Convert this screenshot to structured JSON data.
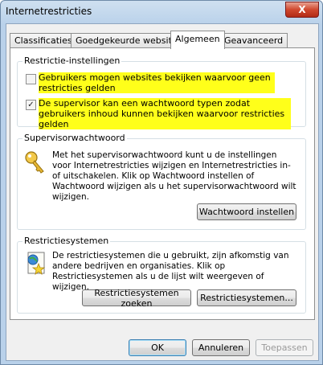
{
  "window": {
    "title": "Internetrestricties",
    "close_glyph": "X"
  },
  "tabs": [
    {
      "label": "Classificaties"
    },
    {
      "label": "Goedgekeurde websites"
    },
    {
      "label": "Algemeen"
    },
    {
      "label": "Geavanceerd"
    }
  ],
  "restriction_settings": {
    "title": "Restrictie-instellingen",
    "options": [
      {
        "label": "Gebruikers mogen websites bekijken waarvoor geen restricties gelden",
        "checked": false
      },
      {
        "label": "De supervisor kan een wachtwoord typen zodat gebruikers inhoud kunnen bekijken waarvoor restricties gelden",
        "checked": true
      }
    ]
  },
  "supervisor_password": {
    "title": "Supervisorwachtwoord",
    "icon": "key-icon",
    "description": "Met het supervisorwachtwoord kunt u de instellingen voor Internetrestricties wijzigen en Internetrestricties in- of uitschakelen. Klik op Wachtwoord instellen of Wachtwoord wijzigen als u het supervisorwachtwoord wilt wijzigen.",
    "button": "Wachtwoord instellen"
  },
  "rating_systems": {
    "title": "Restrictiesystemen",
    "icon": "certificate-icon",
    "description": "De restrictiesystemen die u gebruikt, zijn afkomstig van andere bedrijven en organisaties. Klik op Restrictiesystemen als u de lijst wilt weergeven of wijzigen.",
    "find_button": "Restrictiesystemen zoeken",
    "systems_button": "Restrictiesystemen..."
  },
  "footer": {
    "ok": "OK",
    "cancel": "Annuleren",
    "apply": "Toepassen"
  },
  "colors": {
    "highlight": "#ffff1a",
    "window_frame": "#b9d1ea"
  }
}
